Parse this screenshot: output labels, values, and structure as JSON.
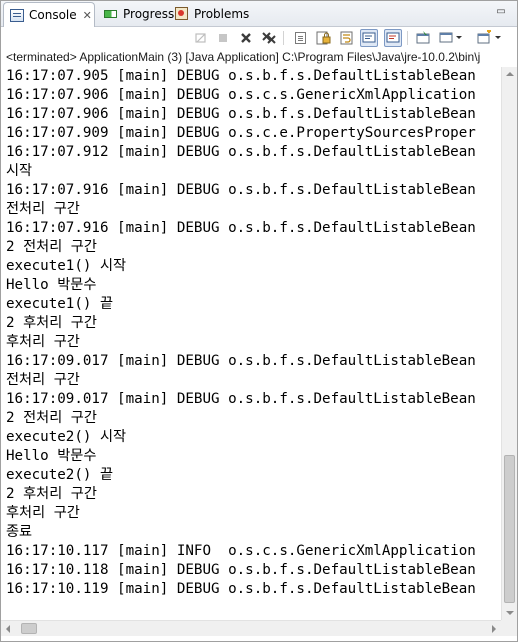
{
  "tabs": [
    {
      "label": "Console",
      "icon": "console-icon",
      "active": true
    },
    {
      "label": "Progress",
      "icon": "progress-icon",
      "active": false
    },
    {
      "label": "Problems",
      "icon": "problems-icon",
      "active": false
    }
  ],
  "tab_close_glyph": "✕",
  "maximize_glyph": "▭",
  "toolbar": {
    "icons": [
      "remove-all-terminated-icon",
      "terminate-icon",
      "remove-launch-icon",
      "remove-all-launches-icon",
      "clear-console-icon",
      "scroll-lock-icon",
      "word-wrap-icon",
      "show-console-on-stdout-icon",
      "show-console-on-stderr-icon",
      "pin-console-icon",
      "display-selected-console-icon",
      "open-console-icon"
    ]
  },
  "status": "<terminated> ApplicationMain (3) [Java Application] C:\\Program Files\\Java\\jre-10.0.2\\bin\\j",
  "console_lines": [
    "16:17:07.905 [main] DEBUG o.s.b.f.s.DefaultListableBean",
    "16:17:07.906 [main] DEBUG o.s.c.s.GenericXmlApplication",
    "16:17:07.906 [main] DEBUG o.s.b.f.s.DefaultListableBean",
    "16:17:07.909 [main] DEBUG o.s.c.e.PropertySourcesProper",
    "16:17:07.912 [main] DEBUG o.s.b.f.s.DefaultListableBean",
    "시작",
    "16:17:07.916 [main] DEBUG o.s.b.f.s.DefaultListableBean",
    "전처리 구간",
    "16:17:07.916 [main] DEBUG o.s.b.f.s.DefaultListableBean",
    "2 전처리 구간",
    "execute1() 시작",
    "Hello 박문수",
    "execute1() 끝",
    "2 후처리 구간",
    "후처리 구간",
    "16:17:09.017 [main] DEBUG o.s.b.f.s.DefaultListableBean",
    "전처리 구간",
    "16:17:09.017 [main] DEBUG o.s.b.f.s.DefaultListableBean",
    "2 전처리 구간",
    "execute2() 시작",
    "Hello 박문수",
    "execute2() 끝",
    "2 후처리 구간",
    "후처리 구간",
    "종료",
    "16:17:10.117 [main] INFO  o.s.c.s.GenericXmlApplication",
    "16:17:10.118 [main] DEBUG o.s.b.f.s.DefaultListableBean",
    "16:17:10.119 [main] DEBUG o.s.b.f.s.DefaultListableBean"
  ]
}
